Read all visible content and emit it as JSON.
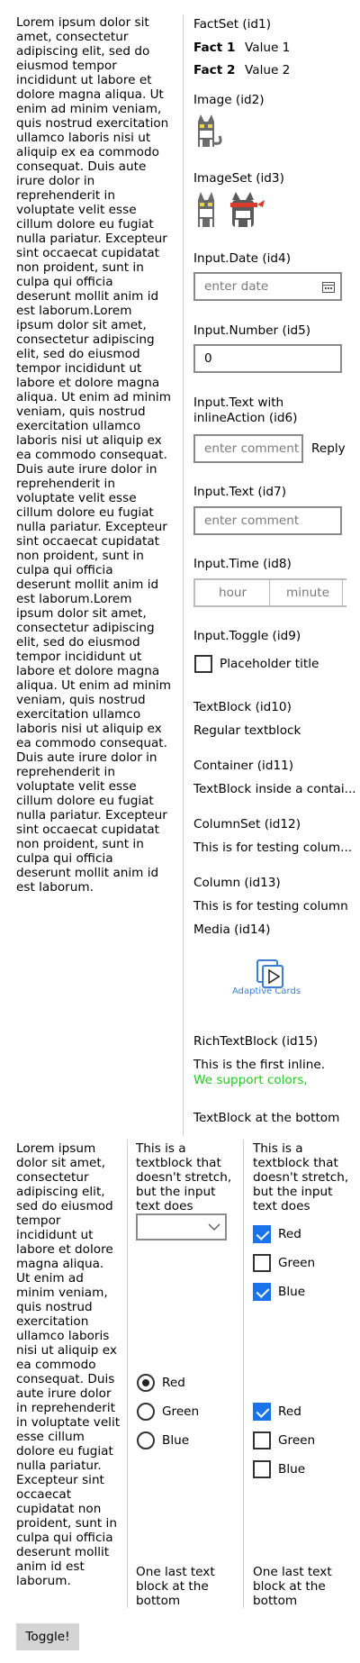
{
  "lorem": "Lorem ipsum dolor sit amet, consectetur adipiscing elit, sed do eiusmod tempor incididunt ut labore et dolore magna aliqua. Ut enim ad minim veniam, quis nostrud exercitation ullamco laboris nisi ut aliquip ex ea commodo consequat. Duis aute irure dolor in reprehenderit in voluptate velit esse cillum dolore eu fugiat nulla pariatur. Excepteur sint occaecat cupidatat non proident, sunt in culpa qui officia deserunt mollit anim id est laborum.Lorem ipsum dolor sit amet, consectetur adipiscing elit, sed do eiusmod tempor incididunt ut labore et dolore magna aliqua. Ut enim ad minim veniam, quis nostrud exercitation ullamco laboris nisi ut aliquip ex ea commodo consequat. Duis aute irure dolor in reprehenderit in voluptate velit esse cillum dolore eu fugiat nulla pariatur. Excepteur sint occaecat cupidatat non proident, sunt in culpa qui officia deserunt mollit anim id est laborum.Lorem ipsum dolor sit amet, consectetur adipiscing elit, sed do eiusmod tempor incididunt ut labore et dolore magna aliqua. Ut enim ad minim veniam, quis nostrud exercitation ullamco laboris nisi ut aliquip ex ea commodo consequat. Duis aute irure dolor in reprehenderit in voluptate velit esse cillum dolore eu fugiat nulla pariatur. Excepteur sint occaecat cupidatat non proident, sunt in culpa qui officia deserunt mollit anim id est laborum.",
  "lorem_short": "Lorem ipsum dolor sit amet, consectetur adipiscing elit, sed do eiusmod tempor incididunt ut labore et dolore magna aliqua. Ut enim ad minim veniam, quis nostrud exercitation ullamco laboris nisi ut aliquip ex ea commodo consequat. Duis aute irure dolor in reprehenderit in voluptate velit esse cillum dolore eu fugiat nulla pariatur. Excepteur sint occaecat cupidatat non proident, sunt in culpa qui officia deserunt mollit anim id est laborum.",
  "factset": {
    "title": "FactSet (id1)",
    "facts": [
      {
        "key": "Fact 1",
        "value": "Value 1"
      },
      {
        "key": "Fact 2",
        "value": "Value 2"
      }
    ]
  },
  "image": {
    "title": "Image (id2)"
  },
  "imageset": {
    "title": "ImageSet (id3)"
  },
  "input_date": {
    "title": "Input.Date (id4)",
    "placeholder": "enter date"
  },
  "input_number": {
    "title": "Input.Number (id5)",
    "value": "0"
  },
  "input_text_action": {
    "title": "Input.Text with inlineAction (id6)",
    "placeholder": "enter comment",
    "action_label": "Reply"
  },
  "input_text": {
    "title": "Input.Text (id7)",
    "placeholder": "enter comment"
  },
  "input_time": {
    "title": "Input.Time (id8)",
    "hour_placeholder": "hour",
    "minute_placeholder": "minute"
  },
  "input_toggle": {
    "title": "Input.Toggle (id9)",
    "label": "Placeholder title",
    "checked": false
  },
  "textblock": {
    "title": "TextBlock (id10)",
    "text": "Regular textblock"
  },
  "container": {
    "title": "Container (id11)",
    "text": "TextBlock inside a contai..."
  },
  "columnset": {
    "title": "ColumnSet (id12)",
    "text": "This is for testing colum..."
  },
  "column": {
    "title": "Column (id13)",
    "text": "This is for testing column"
  },
  "media": {
    "title": "Media (id14)",
    "logo_text": "Adaptive Cards"
  },
  "richtext": {
    "title": "RichTextBlock (id15)",
    "inline1": "This is the first inline. ",
    "inline2": "We support colors,",
    "inline2_color": "#22cc22"
  },
  "bottom_text": "TextBlock at the bottom",
  "bottom_columns": {
    "col2_text": "This is a textblock that doesn't stretch, but the input text does",
    "col3_text": "This is a textblock that doesn't stretch, but the input text does",
    "checks_top": [
      {
        "label": "Red",
        "checked": true
      },
      {
        "label": "Green",
        "checked": false
      },
      {
        "label": "Blue",
        "checked": true
      }
    ],
    "radios": [
      {
        "label": "Red",
        "checked": true
      },
      {
        "label": "Green",
        "checked": false
      },
      {
        "label": "Blue",
        "checked": false
      }
    ],
    "checks_bottom": [
      {
        "label": "Red",
        "checked": true
      },
      {
        "label": "Green",
        "checked": false
      },
      {
        "label": "Blue",
        "checked": false
      }
    ],
    "col2_last": "One last text block at the bottom",
    "col3_last": "One last text block at the bottom"
  },
  "toggle_button": "Toggle!",
  "colors": {
    "accent": "#1a73e8",
    "divider": "#cfcfcf",
    "border": "#8a8a8a",
    "button": "#d4d4d4",
    "green_text": "#22cc22"
  }
}
